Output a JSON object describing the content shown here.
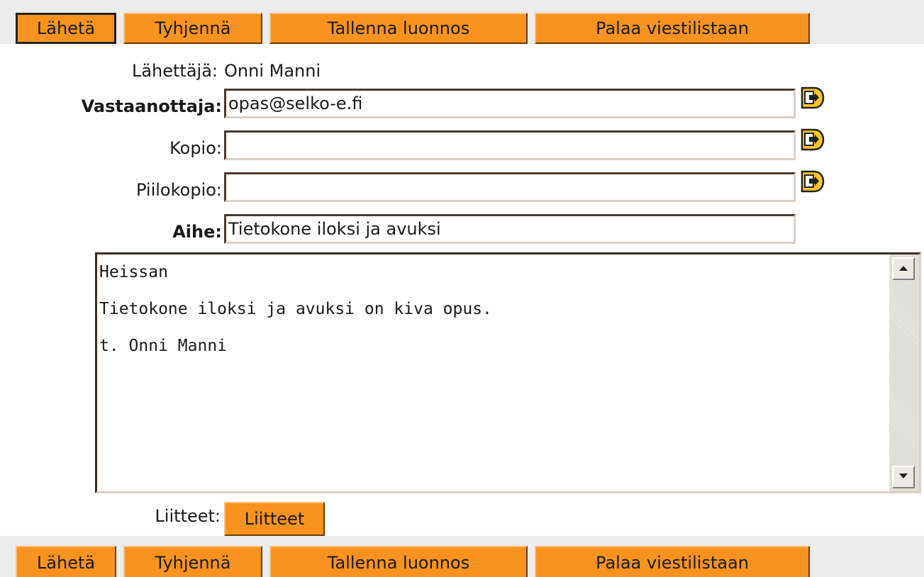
{
  "toolbar": {
    "send_label": "Lähetä",
    "clear_label": "Tyhjennä",
    "save_draft_label": "Tallenna luonnos",
    "back_label": "Palaa viestilistaan"
  },
  "form": {
    "sender_label": "Lähettäjä:",
    "sender_value": "Onni Manni",
    "to_label": "Vastaanottaja:",
    "to_value": "opas@selko-e.fi",
    "cc_label": "Kopio:",
    "cc_value": "",
    "bcc_label": "Piilokopio:",
    "bcc_value": "",
    "subject_label": "Aihe:",
    "subject_value": "Tietokone iloksi ja avuksi",
    "body": "Heissan\n\nTietokone iloksi ja avuksi on kiva opus.\n\nt. Onni Manni",
    "attachments_label": "Liitteet:",
    "attachments_button": "Liitteet"
  },
  "icons": {
    "address_book": "address-book-arrow-icon",
    "scroll_up": "scroll-up-arrow-icon",
    "scroll_down": "scroll-down-arrow-icon"
  },
  "colors": {
    "button_orange": "#f7931e",
    "toolbar_bg": "#ececec"
  }
}
